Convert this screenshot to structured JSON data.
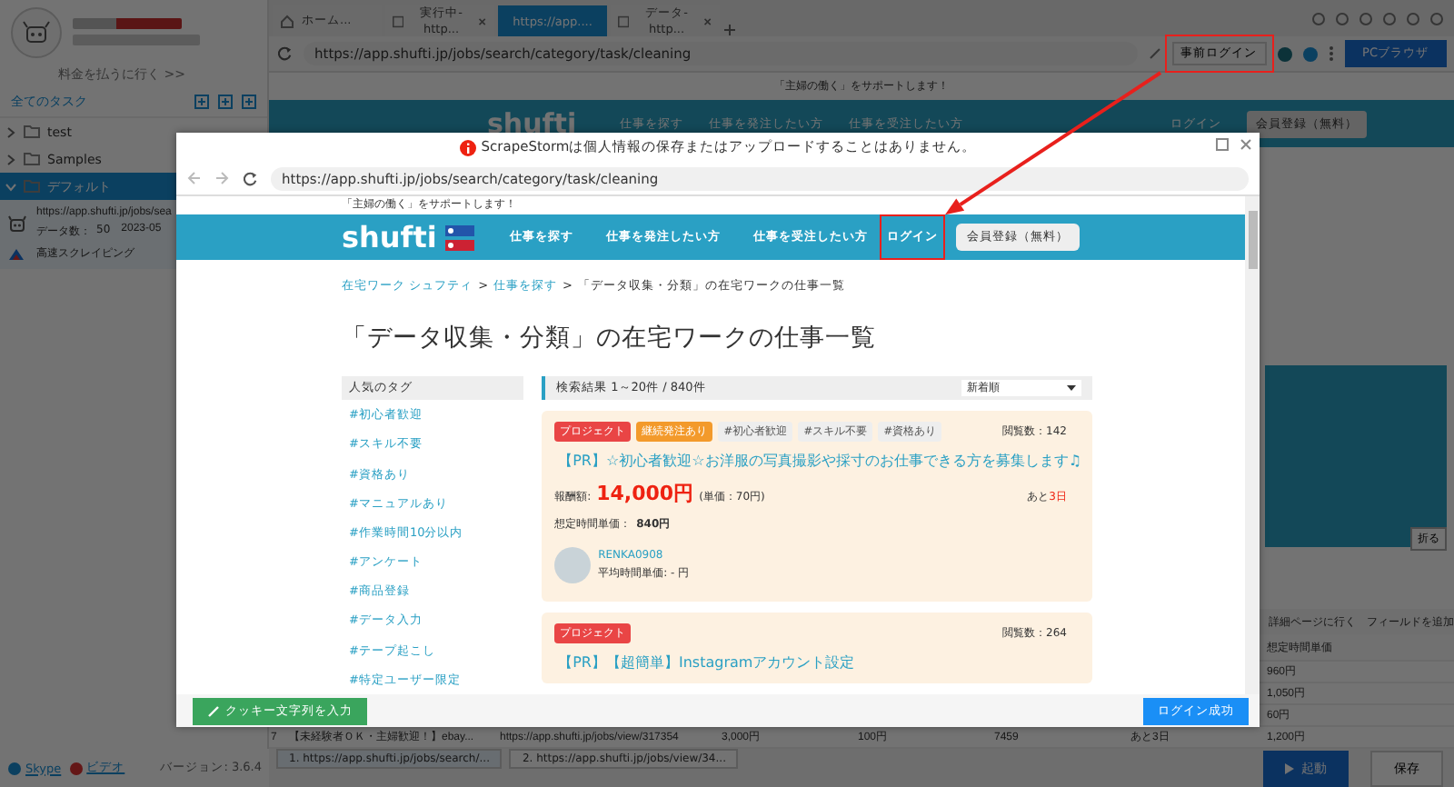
{
  "app": {
    "billing_link": "料金を払うに行く >>",
    "task_header": "全てのタスク",
    "tree": [
      {
        "label": "test",
        "expanded": false,
        "selected": false
      },
      {
        "label": "Samples",
        "expanded": false,
        "selected": false
      },
      {
        "label": "デフォルト",
        "expanded": true,
        "selected": true
      }
    ],
    "task": {
      "url": "https://app.shufti.jp/jobs/sea",
      "count_label": "データ数：",
      "count": "50",
      "date": "2023-05",
      "action": "高速スクレイピング"
    },
    "footer_links": [
      "Skype",
      "ビデオ"
    ],
    "version": "バージョン: 3.6.4"
  },
  "browser_tabs": [
    {
      "label": "ホーム...",
      "kind": "home",
      "selected": false
    },
    {
      "label": "実行中-http...",
      "kind": "page",
      "selected": false
    },
    {
      "label": "https://app....",
      "kind": "page",
      "selected": true
    },
    {
      "label": "データ-http...",
      "kind": "page",
      "selected": false
    }
  ],
  "address_bar": {
    "url": "https://app.shufti.jp/jobs/search/category/task/cleaning",
    "prelogin_button": "事前ログイン",
    "browser_mode": "PCブラウザ"
  },
  "preview": {
    "tagline": "「主婦の働く」をサポートします！",
    "logo": "shufti",
    "nav": [
      "仕事を探す",
      "仕事を発注したい方",
      "仕事を受注したい方"
    ],
    "login": "ログイン",
    "signup": "会員登録（無料）",
    "collapse_button": "折る"
  },
  "data_panel": {
    "detail_link": "詳細ページに行く",
    "add_field": "フィールドを追加",
    "column": "想定時間単価",
    "rows": [
      {
        "hourly_rate": "960円"
      },
      {
        "hourly_rate": "1,050円"
      },
      {
        "hourly_rate": "60円"
      },
      {
        "cells": [
          "7",
          "【未経験者ＯＫ・主婦歓迎！】ebay...",
          "https://app.shufti.jp/jobs/view/317354",
          "3,000円",
          "100円",
          "7459",
          "あと3日"
        ],
        "hourly_rate": "1,200円"
      }
    ]
  },
  "page_tabs": [
    {
      "label": "1. https://app.shufti.jp/jobs/search/...",
      "selected": true
    },
    {
      "label": "2. https://app.shufti.jp/jobs/view/34...",
      "selected": false
    }
  ],
  "run_button": "起動",
  "save_button": "保存",
  "dialog": {
    "notice": "ScrapeStormは個人情報の保存またはアップロードすることはありません。",
    "url": "https://app.shufti.jp/jobs/search/category/task/cleaning",
    "site": {
      "tagline": "「主婦の働く」をサポートします！",
      "logo": "shufti",
      "nav": [
        "仕事を探す",
        "仕事を発注したい方",
        "仕事を受注したい方"
      ],
      "login": "ログイン",
      "signup": "会員登録（無料）",
      "breadcrumb": [
        {
          "label": "在宅ワーク シュフティ",
          "kind": "link"
        },
        {
          "label": ">",
          "kind": "separator"
        },
        {
          "label": "仕事を探す",
          "kind": "link"
        },
        {
          "label": ">",
          "kind": "separator"
        },
        {
          "label": "「データ収集・分類」の在宅ワークの仕事一覧",
          "kind": "current"
        }
      ],
      "heading": "「データ収集・分類」の在宅ワークの仕事一覧",
      "tags_header": "人気のタグ",
      "tags": [
        "#初心者歓迎",
        "#スキル不要",
        "#資格あり",
        "#マニュアルあり",
        "#作業時間10分以内",
        "#アンケート",
        "#商品登録",
        "#データ入力",
        "#テープ起こし",
        "#特定ユーザー限定"
      ],
      "results": "検索結果  1～20件 / 840件",
      "sort": "新着順",
      "jobs": [
        {
          "badges": [
            {
              "label": "プロジェクト",
              "kind": "type"
            },
            {
              "label": "継続発注あり",
              "kind": "option"
            },
            {
              "label": "#初心者歓迎",
              "kind": "tag"
            },
            {
              "label": "#スキル不要",
              "kind": "tag"
            },
            {
              "label": "#資格あり",
              "kind": "tag"
            }
          ],
          "views": "閲覧数：142",
          "title": "【PR】☆初心者歓迎☆お洋服の写真撮影や採寸のお仕事できる方を募集します♫",
          "reward_label": "報酬額:",
          "reward": "14,000円",
          "unit_price": "(単価：70円)",
          "deadline_prefix": "あと",
          "deadline_days": "3日",
          "hourly_label": "想定時間単価：",
          "hourly": "840円",
          "user": "RENKA0908",
          "user_rate": "平均時間単価: - 円"
        },
        {
          "badges": [
            {
              "label": "プロジェクト",
              "kind": "type"
            }
          ],
          "views": "閲覧数：264",
          "title": "【PR】【超簡単】Instagramアカウント設定"
        }
      ]
    },
    "cookie_button": "クッキー文字列を入力",
    "success_button": "ログイン成功"
  }
}
